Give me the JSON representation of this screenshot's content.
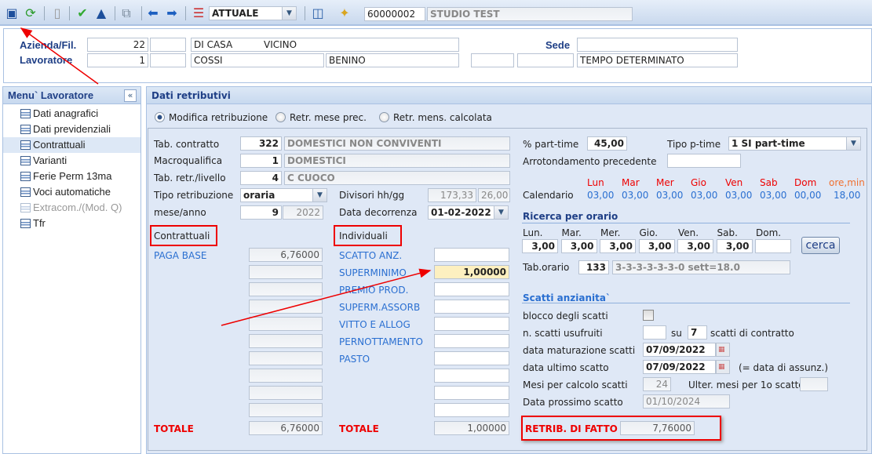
{
  "toolbar": {
    "icons": [
      "save-icon",
      "refresh-icon",
      "delete-icon",
      "confirm-icon",
      "up-icon",
      "copy-icon",
      "arrow-left-icon",
      "arrow-right-icon",
      "list-icon",
      "archive-icon",
      "wand-icon"
    ],
    "period_select": "ATTUALE",
    "company_code": "60000002",
    "company_name": "STUDIO TEST"
  },
  "header": {
    "azienda_label": "Azienda/Fil.",
    "azienda_code": "22",
    "azienda_fil": "",
    "azienda_name1": "DI CASA",
    "azienda_name2": "VICINO",
    "sede_label": "Sede",
    "sede_value": "",
    "lavoratore_label": "Lavoratore",
    "lavoratore_code": "1",
    "lavoratore_sub": "",
    "cognome": "COSSI",
    "nome": "BENINO",
    "extra1": "",
    "extra2": "",
    "contratto_tipo": "TEMPO DETERMINATO"
  },
  "sidebar": {
    "title": "Menu` Lavoratore",
    "items": [
      {
        "label": "Dati anagrafici"
      },
      {
        "label": "Dati previdenziali"
      },
      {
        "label": "Contrattuali"
      },
      {
        "label": "Varianti"
      },
      {
        "label": "Ferie Perm 13ma"
      },
      {
        "label": "Voci automatiche"
      },
      {
        "label": "Extracom./(Mod. Q)"
      },
      {
        "label": "Tfr"
      }
    ]
  },
  "main": {
    "title": "Dati retributivi",
    "radios": [
      "Modifica retribuzione",
      "Retr. mese prec.",
      "Retr. mens. calcolata"
    ],
    "tab_contratto": {
      "label": "Tab. contratto",
      "code": "322",
      "desc": "DOMESTICI NON CONVIVENTI"
    },
    "macroqualifica": {
      "label": "Macroqualifica",
      "code": "1",
      "desc": "DOMESTICI"
    },
    "tab_retr": {
      "label": "Tab. retr./livello",
      "code": "4",
      "desc": "C CUOCO"
    },
    "tipo_retribuzione": {
      "label": "Tipo retribuzione",
      "value": "oraria"
    },
    "divisori": {
      "label": "Divisori hh/gg",
      "hh": "173,33",
      "gg": "26,00"
    },
    "mese_anno": {
      "label": "mese/anno",
      "mese": "9",
      "anno": "2022"
    },
    "data_decorrenza": {
      "label": "Data decorrenza",
      "value": "01-02-2022"
    },
    "contrattuali": {
      "title": "Contrattuali",
      "rows": [
        {
          "label": "PAGA BASE",
          "value": "6,76000"
        },
        {
          "label": "",
          "value": ""
        },
        {
          "label": "",
          "value": ""
        },
        {
          "label": "",
          "value": ""
        },
        {
          "label": "",
          "value": ""
        },
        {
          "label": "",
          "value": ""
        },
        {
          "label": "",
          "value": ""
        },
        {
          "label": "",
          "value": ""
        },
        {
          "label": "",
          "value": ""
        },
        {
          "label": "",
          "value": ""
        }
      ],
      "total_label": "TOTALE",
      "total": "6,76000"
    },
    "individuali": {
      "title": "Individuali",
      "rows": [
        {
          "label": "SCATTO ANZ.",
          "value": ""
        },
        {
          "label": "SUPERMINIMO",
          "value": "1,00000"
        },
        {
          "label": "PREMIO PROD.",
          "value": ""
        },
        {
          "label": "SUPERM.ASSORB",
          "value": ""
        },
        {
          "label": "VITTO E ALLOG",
          "value": ""
        },
        {
          "label": "PERNOTTAMENTO",
          "value": ""
        },
        {
          "label": "PASTO",
          "value": ""
        },
        {
          "label": "",
          "value": ""
        },
        {
          "label": "",
          "value": ""
        },
        {
          "label": "",
          "value": ""
        }
      ],
      "total_label": "TOTALE",
      "total": "1,00000"
    },
    "part_time": {
      "label": "% part-time",
      "value": "45,00",
      "tipo_label": "Tipo p-time",
      "tipo_value": "1 SI part-time"
    },
    "arrotondamento": {
      "label": "Arrotondamento precedente",
      "value": ""
    },
    "calendario": {
      "label": "Calendario",
      "days": [
        "Lun",
        "Mar",
        "Mer",
        "Gio",
        "Ven",
        "Sab",
        "Dom",
        "ore,min"
      ],
      "values": [
        "03,00",
        "03,00",
        "03,00",
        "03,00",
        "03,00",
        "03,00",
        "00,00",
        "18,00"
      ]
    },
    "ricerca": {
      "title": "Ricerca per orario",
      "days": [
        "Lun.",
        "Mar.",
        "Mer.",
        "Gio.",
        "Ven.",
        "Sab.",
        "Dom."
      ],
      "values": [
        "3,00",
        "3,00",
        "3,00",
        "3,00",
        "3,00",
        "3,00",
        ""
      ],
      "button": "cerca",
      "tab_orario_label": "Tab.orario",
      "tab_orario_code": "133",
      "tab_orario_desc": "3-3-3-3-3-3-0 sett=18.0"
    },
    "scatti": {
      "title": "Scatti anzianita`",
      "blocco_label": "blocco degli scatti",
      "blocco_checked": false,
      "usufruiti_label": "n. scatti usufruiti",
      "usufruiti": "",
      "su_label": "su",
      "contratto_scatti": "7",
      "contratto_label": "scatti di contratto",
      "maturazione_label": "data maturazione scatti",
      "maturazione": "07/09/2022",
      "ultimo_label": "data ultimo scatto",
      "ultimo": "07/09/2022",
      "ultimo_note": "(= data di assunz.)",
      "mesi_label": "Mesi per calcolo scatti",
      "mesi": "24",
      "ulter_label": "Ulter. mesi per 1o scatto",
      "ulter": "",
      "prossimo_label": "Data prossimo scatto",
      "prossimo": "01/10/2024"
    },
    "retrib_fatto": {
      "label": "RETRIB. DI FATTO",
      "value": "7,76000"
    }
  },
  "colors": {
    "accent": "#1f3f86",
    "link": "#2a6fd1",
    "highlight": "#e00000",
    "panel": "#dfe8f6"
  }
}
